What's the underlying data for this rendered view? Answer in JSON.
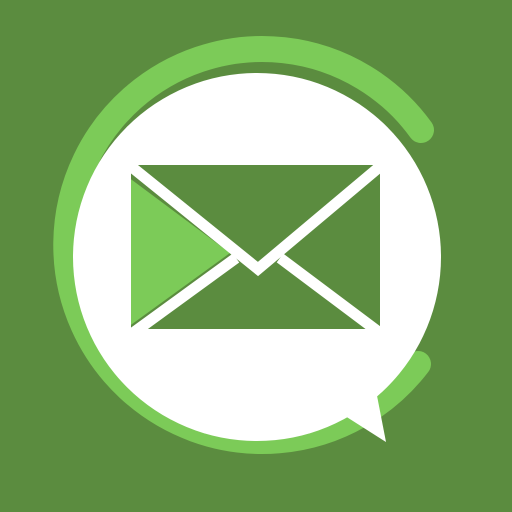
{
  "icon": {
    "name": "mail-chat-icon",
    "colors": {
      "background": "#5b8c3f",
      "ring": "#7ccb58",
      "bubble": "#ffffff",
      "envelope_dark": "#5b8c3f",
      "envelope_light": "#7ccb58"
    }
  }
}
